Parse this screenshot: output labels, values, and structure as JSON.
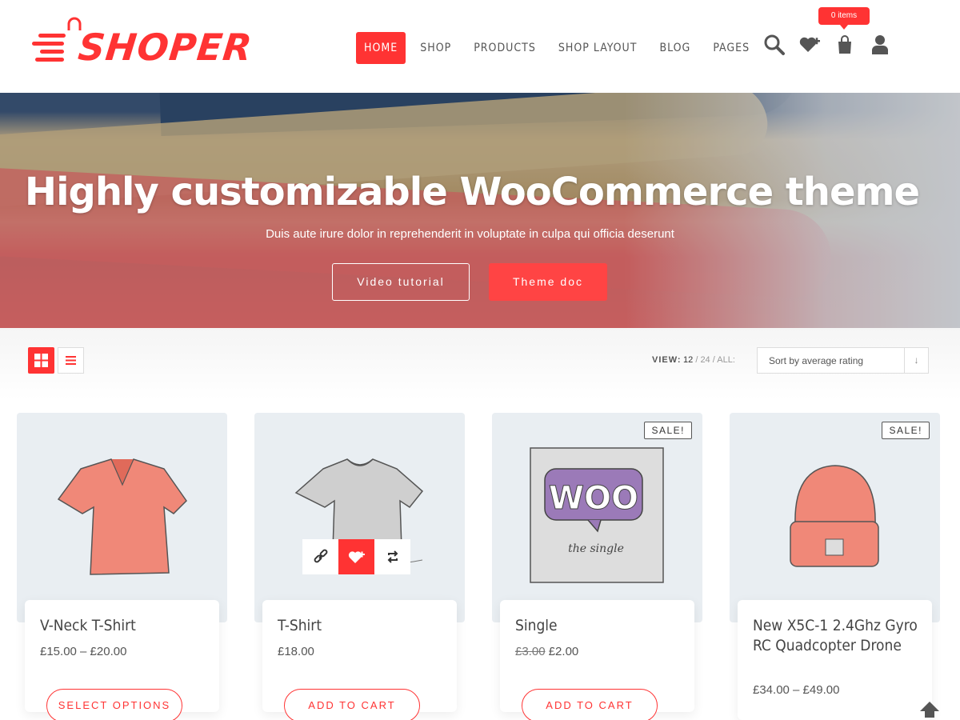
{
  "brand": {
    "logo_text": "SHOPER",
    "accent_color": "#ff3333"
  },
  "nav": {
    "items": [
      {
        "label": "HOME",
        "active": true
      },
      {
        "label": "SHOP"
      },
      {
        "label": "PRODUCTS"
      },
      {
        "label": "SHOP LAYOUT"
      },
      {
        "label": "BLOG"
      },
      {
        "label": "PAGES"
      }
    ],
    "icons": [
      "search-icon",
      "wishlist-icon",
      "cart-icon",
      "account-icon"
    ],
    "cart_badge": "0 items"
  },
  "hero": {
    "title": "Highly customizable WooCommerce theme",
    "subtitle": "Duis aute irure dolor in reprehenderit in voluptate in culpa qui officia deserunt",
    "btn_video": "Video tutorial",
    "btn_doc": "Theme doc"
  },
  "toolbar": {
    "view_label": "VIEW:",
    "view_options": [
      "12",
      "24",
      "ALL:"
    ],
    "view_selected": "12",
    "sort_value": "Sort by average rating"
  },
  "products": [
    {
      "title": "V-Neck T-Shirt",
      "price": "£15.00 – £20.00",
      "old_price": "",
      "button": "SELECT OPTIONS",
      "sale": ""
    },
    {
      "title": "T-Shirt",
      "price": "£18.00",
      "old_price": "",
      "button": "ADD TO CART",
      "sale": ""
    },
    {
      "title": "Single",
      "price": "£2.00",
      "old_price": "£3.00",
      "button": "ADD TO CART",
      "sale": "SALE!"
    },
    {
      "title": "New X5C-1 2.4Ghz Gyro RC Quadcopter Drone",
      "price": "£34.00 – £49.00",
      "old_price": "",
      "button": "",
      "sale": "SALE!"
    }
  ],
  "woo_artwork": {
    "logo": "WOO",
    "caption": "the single"
  }
}
